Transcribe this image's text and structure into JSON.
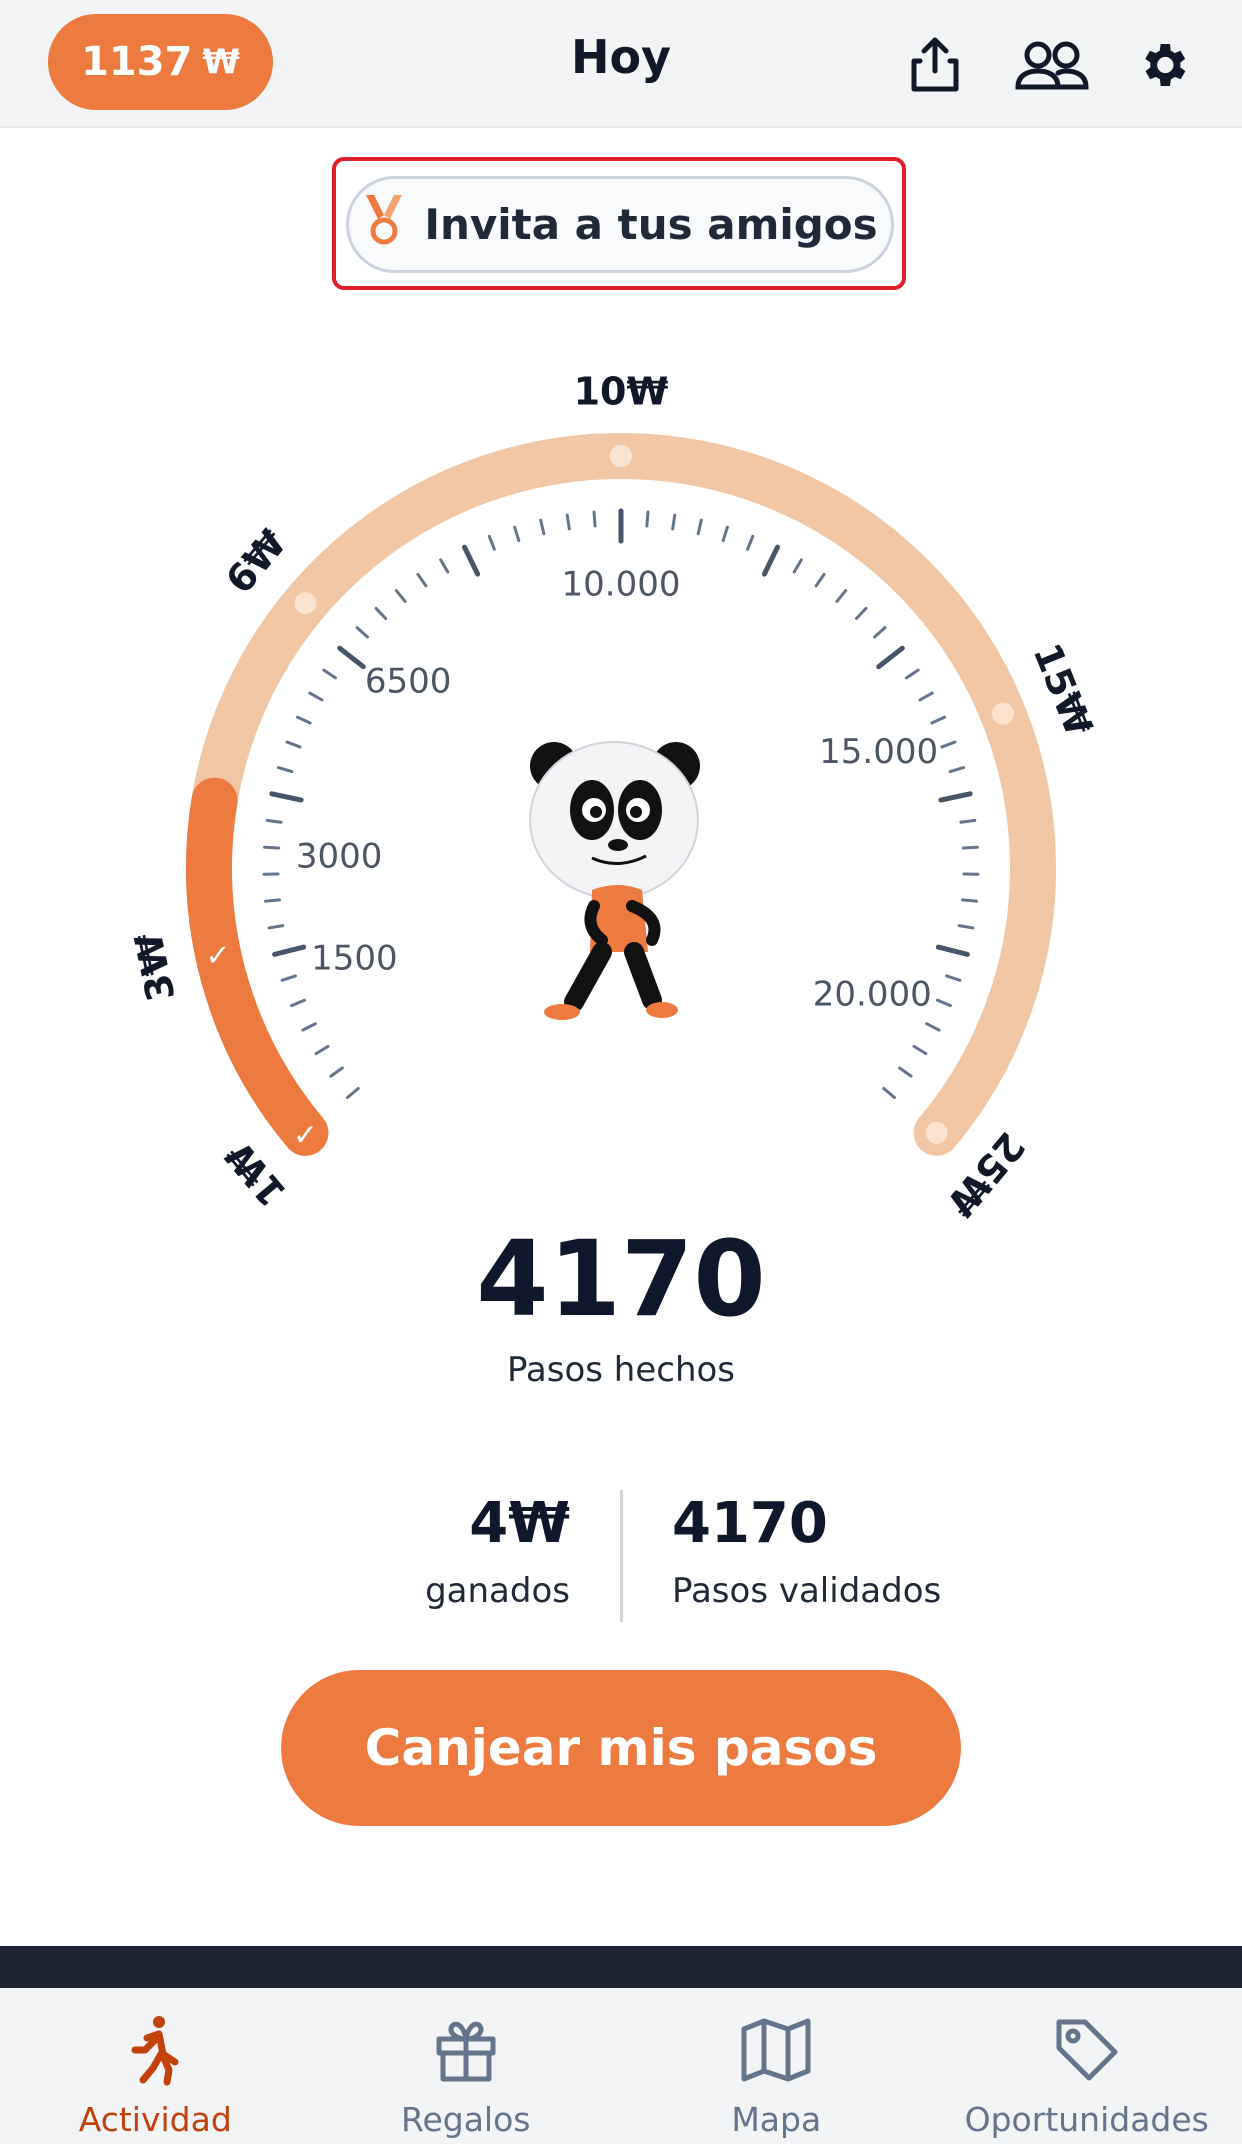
{
  "header": {
    "coin_balance": "1137",
    "coin_symbol": "₩",
    "title": "Hoy",
    "icons": [
      "share-icon",
      "friends-icon",
      "gear-icon"
    ]
  },
  "invite": {
    "label": "Invita a tus amigos",
    "icon": "medal-icon"
  },
  "gauge": {
    "reward_labels": [
      "1₩",
      "3₩",
      "6₩",
      "10₩",
      "15₩",
      "25₩"
    ],
    "step_labels": [
      "1500",
      "3000",
      "6500",
      "10.000",
      "15.000",
      "20.000"
    ],
    "progress_fraction": 0.19
  },
  "activity": {
    "steps_done": "4170",
    "steps_done_label": "Pasos hechos",
    "earned_value": "4₩",
    "earned_label": "ganados",
    "validated_value": "4170",
    "validated_label": "Pasos validados"
  },
  "redeem_button": "Canjear mis pasos",
  "tabs": [
    {
      "label": "Actividad",
      "icon": "walker-icon",
      "active": true
    },
    {
      "label": "Regalos",
      "icon": "gift-icon",
      "active": false
    },
    {
      "label": "Mapa",
      "icon": "map-icon",
      "active": false
    },
    {
      "label": "Oportunidades",
      "icon": "tag-icon",
      "active": false
    }
  ],
  "colors": {
    "accent": "#ed7a3f",
    "accent_light": "#f0c6a4",
    "active_tab": "#c2410c",
    "text_dark": "#0f172a"
  }
}
